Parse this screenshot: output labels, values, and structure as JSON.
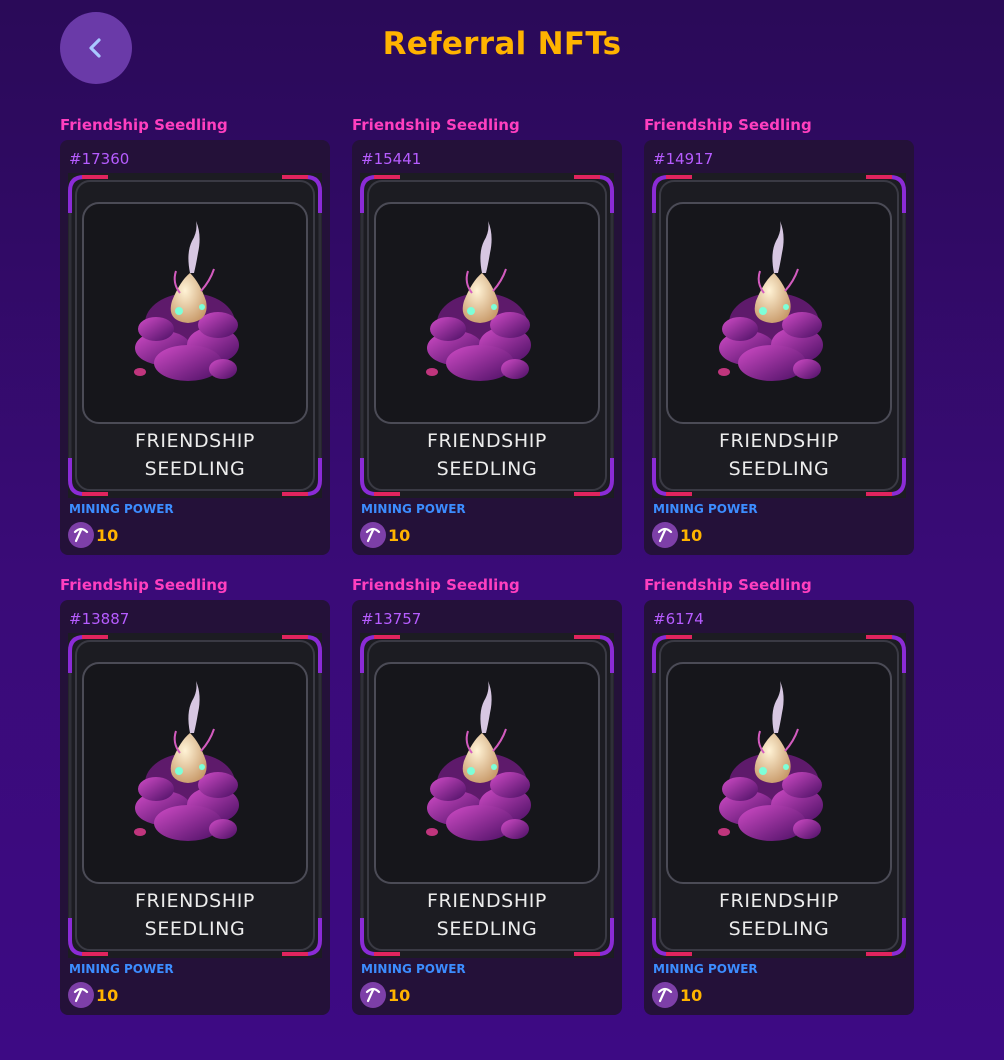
{
  "header": {
    "title": "Referral NFTs",
    "back_icon": "chevron-left-icon"
  },
  "colors": {
    "background": "#3a0b78",
    "title": "#ffb300",
    "card_title": "#ff3fbf",
    "card_id": "#b65cff",
    "mining_label": "#3c8dff",
    "mining_value": "#ffb300"
  },
  "nfts": [
    {
      "title": "Friendship Seedling",
      "id": "#17360",
      "name_line1": "FRIENDSHIP",
      "name_line2": "SEEDLING",
      "mining_label": "MINING POWER",
      "mining_value": "10"
    },
    {
      "title": "Friendship Seedling",
      "id": "#15441",
      "name_line1": "FRIENDSHIP",
      "name_line2": "SEEDLING",
      "mining_label": "MINING POWER",
      "mining_value": "10"
    },
    {
      "title": "Friendship Seedling",
      "id": "#14917",
      "name_line1": "FRIENDSHIP",
      "name_line2": "SEEDLING",
      "mining_label": "MINING POWER",
      "mining_value": "10"
    },
    {
      "title": "Friendship Seedling",
      "id": "#13887",
      "name_line1": "FRIENDSHIP",
      "name_line2": "SEEDLING",
      "mining_label": "MINING POWER",
      "mining_value": "10"
    },
    {
      "title": "Friendship Seedling",
      "id": "#13757",
      "name_line1": "FRIENDSHIP",
      "name_line2": "SEEDLING",
      "mining_label": "MINING POWER",
      "mining_value": "10"
    },
    {
      "title": "Friendship Seedling",
      "id": "#6174",
      "name_line1": "FRIENDSHIP",
      "name_line2": "SEEDLING",
      "mining_label": "MINING POWER",
      "mining_value": "10"
    }
  ]
}
